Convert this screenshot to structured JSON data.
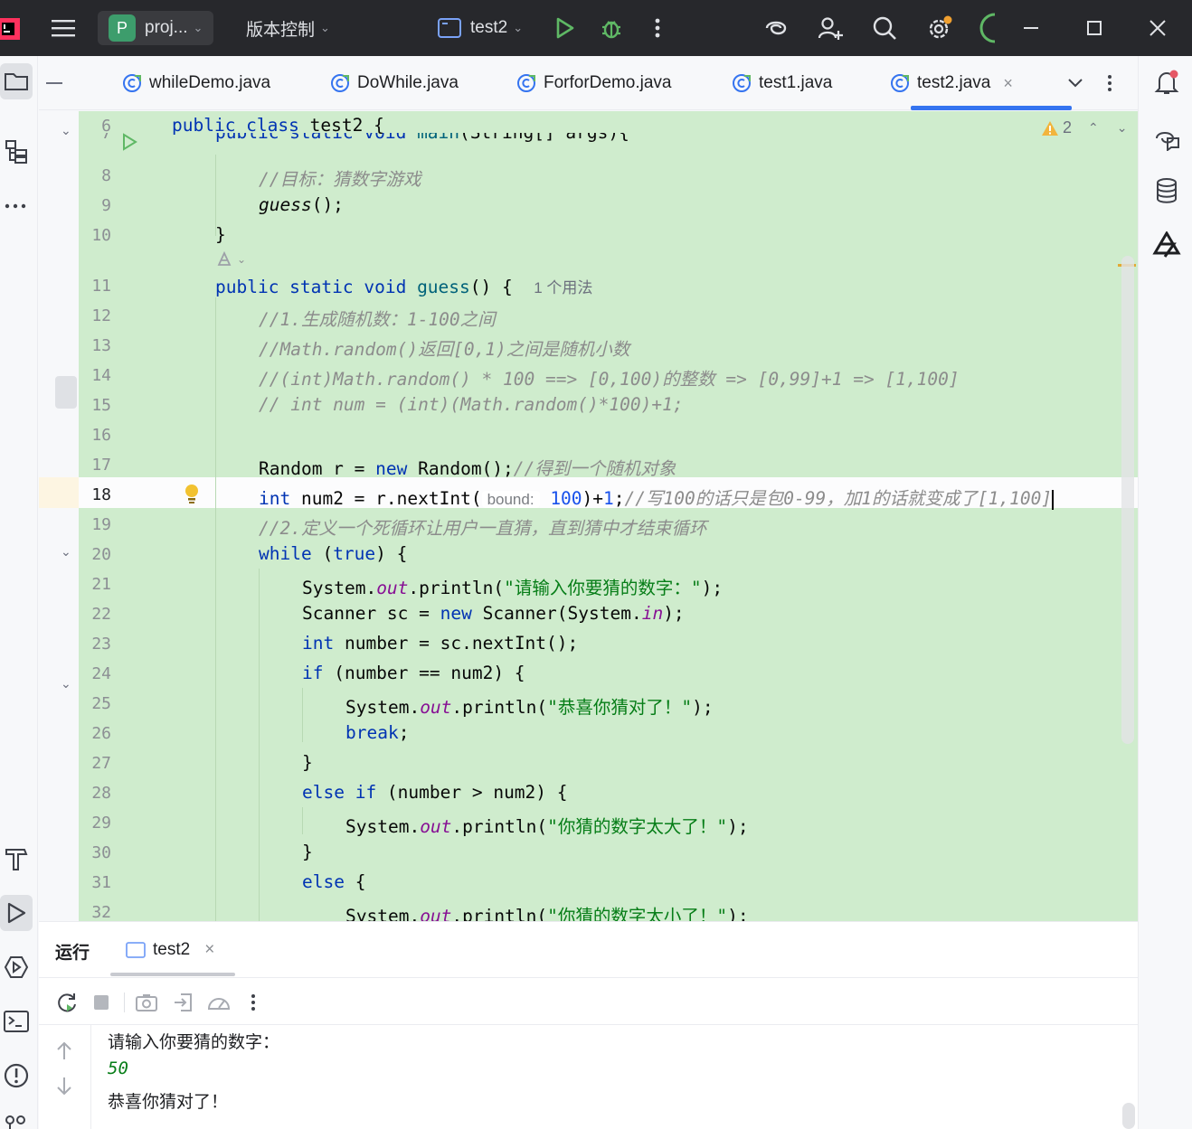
{
  "titlebar": {
    "project_badge": "P",
    "project": "proj...",
    "vcs": "版本控制",
    "run_config": "test2"
  },
  "tabs": [
    {
      "label": "whileDemo.java"
    },
    {
      "label": "DoWhile.java"
    },
    {
      "label": "ForforDemo.java"
    },
    {
      "label": "test1.java"
    },
    {
      "label": "test2.java",
      "active": true
    }
  ],
  "editor": {
    "warning_count": "2",
    "current_line": 18,
    "usage_hint": "1 个用法",
    "param_hint": "bound:",
    "lines": {
      "l6": {
        "n": "6",
        "a": "public class ",
        "b": "test2 {"
      },
      "l7": {
        "n": "7",
        "a": "public static void ",
        "b": "main",
        "c": "(String[] args){"
      },
      "l8": {
        "n": "8",
        "a": "//目标：猜数字游戏"
      },
      "l9": {
        "n": "9",
        "a": "guess",
        "b": "();"
      },
      "l10": {
        "n": "10",
        "a": "}"
      },
      "l11": {
        "n": "11",
        "a": "public static void ",
        "b": "guess",
        "c": "() {"
      },
      "l12": {
        "n": "12",
        "a": "//1.生成随机数：1-100之间"
      },
      "l13": {
        "n": "13",
        "a": "//Math.random()返回[0,1)之间是随机小数"
      },
      "l14": {
        "n": "14",
        "a": "//(int)Math.random() * 100 ==> [0,100)的整数 => [0,99]+1 => [1,100]"
      },
      "l15": {
        "n": "15",
        "a": "// int num = (int)(Math.random()*100)+1;"
      },
      "l16": {
        "n": "16"
      },
      "l17": {
        "n": "17",
        "a": "Random r = ",
        "b": "new",
        "c": " Random();",
        "d": "//得到一个随机对象"
      },
      "l18": {
        "n": "18",
        "a": "int",
        "b": " num2 = r.nextInt(",
        "c": "100",
        "d": ")+",
        "e": "1",
        "f": ";",
        "g": "//写100的话只是包0-99，加1的话就变成了[1,100]"
      },
      "l19": {
        "n": "19",
        "a": "//2.定义一个死循环让用户一直猜，直到猜中才结束循环"
      },
      "l20": {
        "n": "20",
        "a": "while",
        "b": " (",
        "c": "true",
        "d": ") {"
      },
      "l21": {
        "n": "21",
        "a": "System.",
        "b": "out",
        "c": ".println(",
        "d": "\"请输入你要猜的数字：\"",
        "e": ");"
      },
      "l22": {
        "n": "22",
        "a": "Scanner sc = ",
        "b": "new",
        "c": " Scanner(System.",
        "d": "in",
        "e": ");"
      },
      "l23": {
        "n": "23",
        "a": "int",
        "b": " number = sc.nextInt();"
      },
      "l24": {
        "n": "24",
        "a": "if",
        "b": " (number == num2) {"
      },
      "l25": {
        "n": "25",
        "a": "System.",
        "b": "out",
        "c": ".println(",
        "d": "\"恭喜你猜对了！\"",
        "e": ");"
      },
      "l26": {
        "n": "26",
        "a": "break",
        "b": ";"
      },
      "l27": {
        "n": "27",
        "a": "}"
      },
      "l28": {
        "n": "28",
        "a": "else if",
        "b": " (number > num2) {"
      },
      "l29": {
        "n": "29",
        "a": "System.",
        "b": "out",
        "c": ".println(",
        "d": "\"你猜的数字太大了！\"",
        "e": ");"
      },
      "l30": {
        "n": "30",
        "a": "}"
      },
      "l31": {
        "n": "31",
        "a": "else",
        "b": " {"
      },
      "l32": {
        "n": "32",
        "a": "System.",
        "b": "out",
        "c": ".println(",
        "d": "\"你猜的数字太小了！\"",
        "e": ");"
      }
    }
  },
  "run_panel": {
    "title": "运行",
    "tab": "test2",
    "output": [
      "请输入你要猜的数字：",
      "50",
      "恭喜你猜对了！"
    ]
  },
  "colors": {
    "changed_bg": "#cfeccd",
    "keyword": "#0033b3",
    "string": "#067d17",
    "comment": "#8c8c8c",
    "accent": "#3574f0"
  },
  "icons": {
    "titlebar": [
      "intellij-logo-icon",
      "hamburger-menu-icon",
      "run-icon",
      "debug-icon",
      "more-vert-icon",
      "ai-assistant-icon",
      "add-user-icon",
      "search-icon",
      "settings-icon",
      "progress-icon",
      "minimize-icon",
      "maximize-icon",
      "close-icon"
    ],
    "left": [
      "project-folder-icon",
      "structure-icon",
      "more-icon",
      "build-hammer-icon",
      "run-icon",
      "services-icon",
      "terminal-icon",
      "problems-icon",
      "git-icon"
    ],
    "right": [
      "notifications-icon",
      "ai-chat-icon",
      "database-icon",
      "plugin-icon"
    ]
  }
}
